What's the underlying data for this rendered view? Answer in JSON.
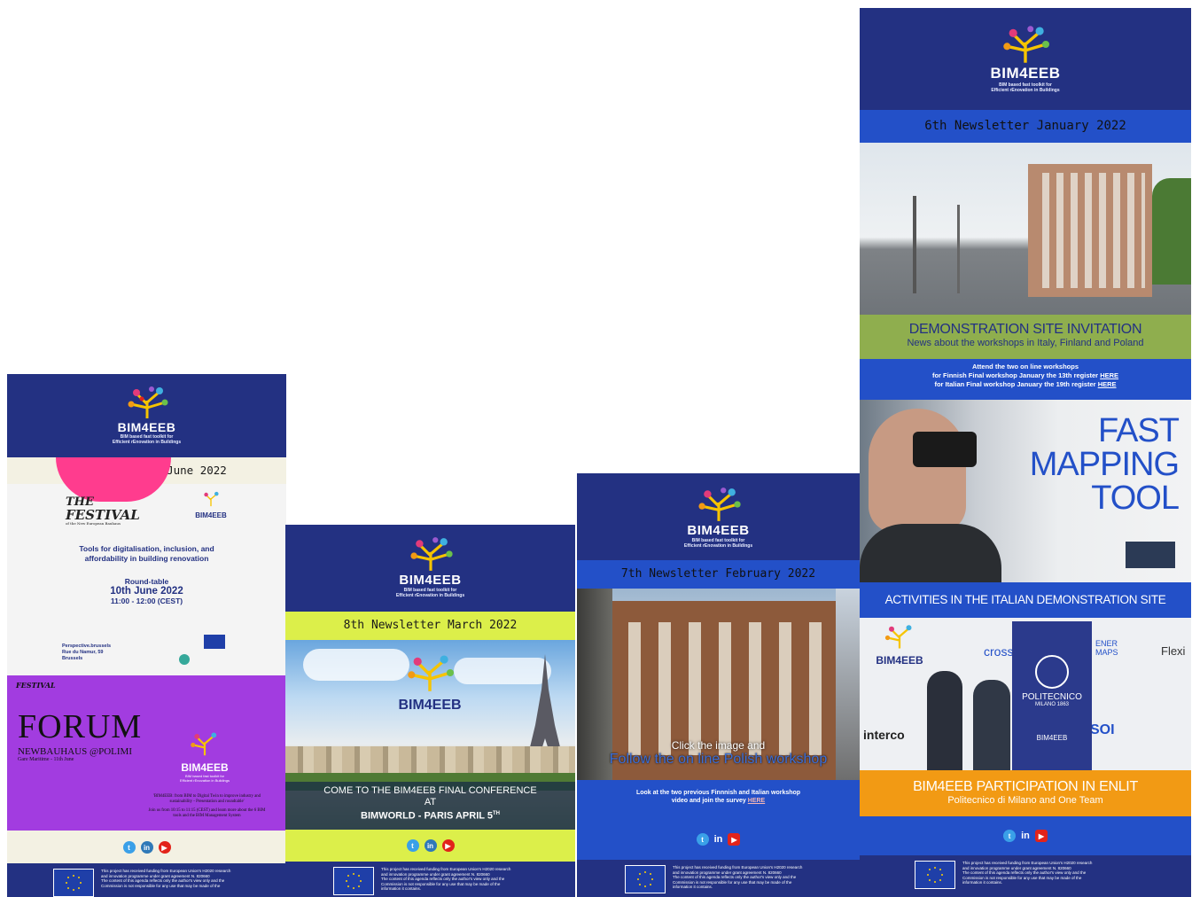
{
  "logo": {
    "name": "BIM4EEB",
    "tagline_1": "BIM based fast toolkit for",
    "tagline_2": "Efficient rEnovation in Buildings"
  },
  "footer": {
    "funding_1": "This project has received funding from European Union's H2020 research",
    "funding_2": "and innovation programme under grant agreement N. 820660",
    "disclaimer_1": "The content of this agenda reflects only the author's view only and the",
    "disclaimer_2": "Commission is not responsible for any use that may be made of the",
    "disclaimer_3": "information it contains."
  },
  "social": {
    "twitter": "t",
    "linkedin": "in",
    "youtube": "▶"
  },
  "nl9": {
    "title": "9th  Newsletter June  2022",
    "festival_1": "THE",
    "festival_2": "FESTIVAL",
    "festival_sub": "of the New European Bauhaus",
    "tools_1": "Tools for digitalisation, inclusion, and",
    "tools_2": "affordability in building renovation",
    "roundtable": "Round-table",
    "date": "10th June 2022",
    "time": "11:00 - 12:00 (CEST)",
    "venue_1": "Perspective.brussels",
    "venue_2": "Rue du Namur, 59",
    "venue_3": "Brussels",
    "forum": "FORUM",
    "forum_sub": "NEWBAUHAUS @POLIMI",
    "forum_place": "Gare Maritime - 11th June",
    "forum_text_1": "'BIM4EEB: from BIM to Digital Twin to improve industry and",
    "forum_text_2": "sustainability - Presentation and roundtable'",
    "forum_text_3": "Join us from 10:15 to 11:15 (CEST) and learn more about the 6 BIM",
    "forum_text_4": "tools and the BIM Management System"
  },
  "nl8": {
    "title": "8th  Newsletter March  2022",
    "cta_1": "COME TO THE BIM4EEB FINAL CONFERENCE",
    "cta_2": "AT",
    "cta_3": "BIMWORLD - PARIS APRIL 5",
    "cta_3_sup": "TH"
  },
  "nl7": {
    "title": "7th  Newsletter February  2022",
    "click": "Click the image and",
    "follow": "Follow the on line Polish workshop",
    "look_1": "Look at the two previous Finnnish and Italian workshop",
    "look_2": "video and join the survey",
    "here": "HERE"
  },
  "nl6": {
    "title": "6th  Newsletter January  2022",
    "demo_title": "DEMONSTRATION SITE INVITATION",
    "demo_sub": "News about the workshops in Italy, Finland and Poland",
    "attend": "Attend the two on line workshops",
    "finnish": "for Finnish Final workshop  January the 13th register",
    "italian": "for Italian Final workshop January the 19th register",
    "here": "HERE",
    "fmt_1": "FAST",
    "fmt_2": "MAPPING",
    "fmt_3": "TOOL",
    "activities": "ACTIVITIES IN THE ITALIAN DEMONSTRATION SITE",
    "enlit_title": "BIM4EEB PARTICIPATION IN ENLIT",
    "enlit_sub": "Politecnico di Milano and One Team",
    "poli": "POLITECNICO",
    "poli_sub": "MILANO 1863",
    "booth_1": "cross",
    "booth_2": "Flexi",
    "booth_3": "interco",
    "booth_4": "SOI",
    "booth_5": "ENER MAPS"
  },
  "colors": {
    "navy": "#233182",
    "blue_band": "#2350c8",
    "cream": "#f3f1e3",
    "lime": "#dcef4a",
    "green": "#8fae4e",
    "orange": "#f29a14",
    "purple": "#a23ce0"
  }
}
